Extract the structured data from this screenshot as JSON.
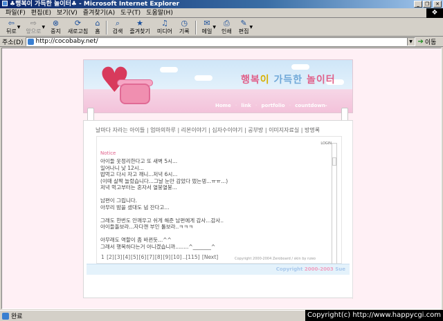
{
  "window": {
    "title": "♣행복이 가득한 놀이터♣ - Microsoft Internet Explorer"
  },
  "menu": [
    "파일(F)",
    "편집(E)",
    "보기(V)",
    "즐겨찾기(A)",
    "도구(T)",
    "도움말(H)"
  ],
  "toolbar": {
    "back": "뒤로",
    "forward": "앞으로",
    "stop": "중지",
    "refresh": "새로고침",
    "home": "홈",
    "search": "검색",
    "favorites": "즐겨찾기",
    "media": "미디어",
    "history": "기록",
    "mail": "메일",
    "print": "인쇄",
    "edit": "편집"
  },
  "address": {
    "label": "주소(D)",
    "url": "http://cocobaby.net/",
    "go_label": "이동"
  },
  "site": {
    "title": {
      "p1": "행복",
      "p2": "이 ",
      "p3": "가득한 ",
      "p4": "놀이터"
    },
    "nav": [
      "Home",
      "link",
      "portfolio",
      "countdown-"
    ],
    "topnav": "날마다 자라는 아이들 | 엄마의하루 | 리본이야기 | 십자수이야기 | 공부방 | 이미지자료실 | 방명록",
    "login": "LOGIN",
    "notice_title": "Notice",
    "message": "아이들 웃정리한다고 또 새벽 5시...\n일어나니 낮 12시...\n밥먹고 다시 자고 깨니...저녁 6시...\n(이때 살짝 놀랐습니다...그날 눈만 감았다 떴는뎅...ㅠㅠ...)\n저녁 먹고부터는 혼자서 열붕열붕...\n\n남편이 그립니다.\n아무리 밤을 샜대도 넘 잔다고...\n\n그래도 한번도 안깨우고 쉬게 해준 남편에게 감사...감사..\n아이들돌보라...자다깬 부인 툴보라..ㅋㅋㅋ\n\n아무래도 역할이 좀 바뀐듯...^^\n그래서 행복하다는거 아니겠습니까........^_______^",
    "pagination": [
      "1",
      "[2]",
      "[3]",
      "[4]",
      "[5]",
      "[6]",
      "[7]",
      "[8]",
      "[9]",
      "[10]",
      "..[115]",
      "[Next]"
    ],
    "small_copyright": "Copyright 2000-2004 Zeroboard / skin by nzeo",
    "footer": {
      "prefix": "Copyright ",
      "year": "2000-2003",
      "suffix": " Sue"
    }
  },
  "status": {
    "text": "완료"
  },
  "watermark": "Copyright(c) http://www.happycgi.com",
  "colors": {
    "accent_pink": "#e0608a",
    "sky_blue": "#cfe6f8",
    "page_bg": "#fff0f5"
  }
}
